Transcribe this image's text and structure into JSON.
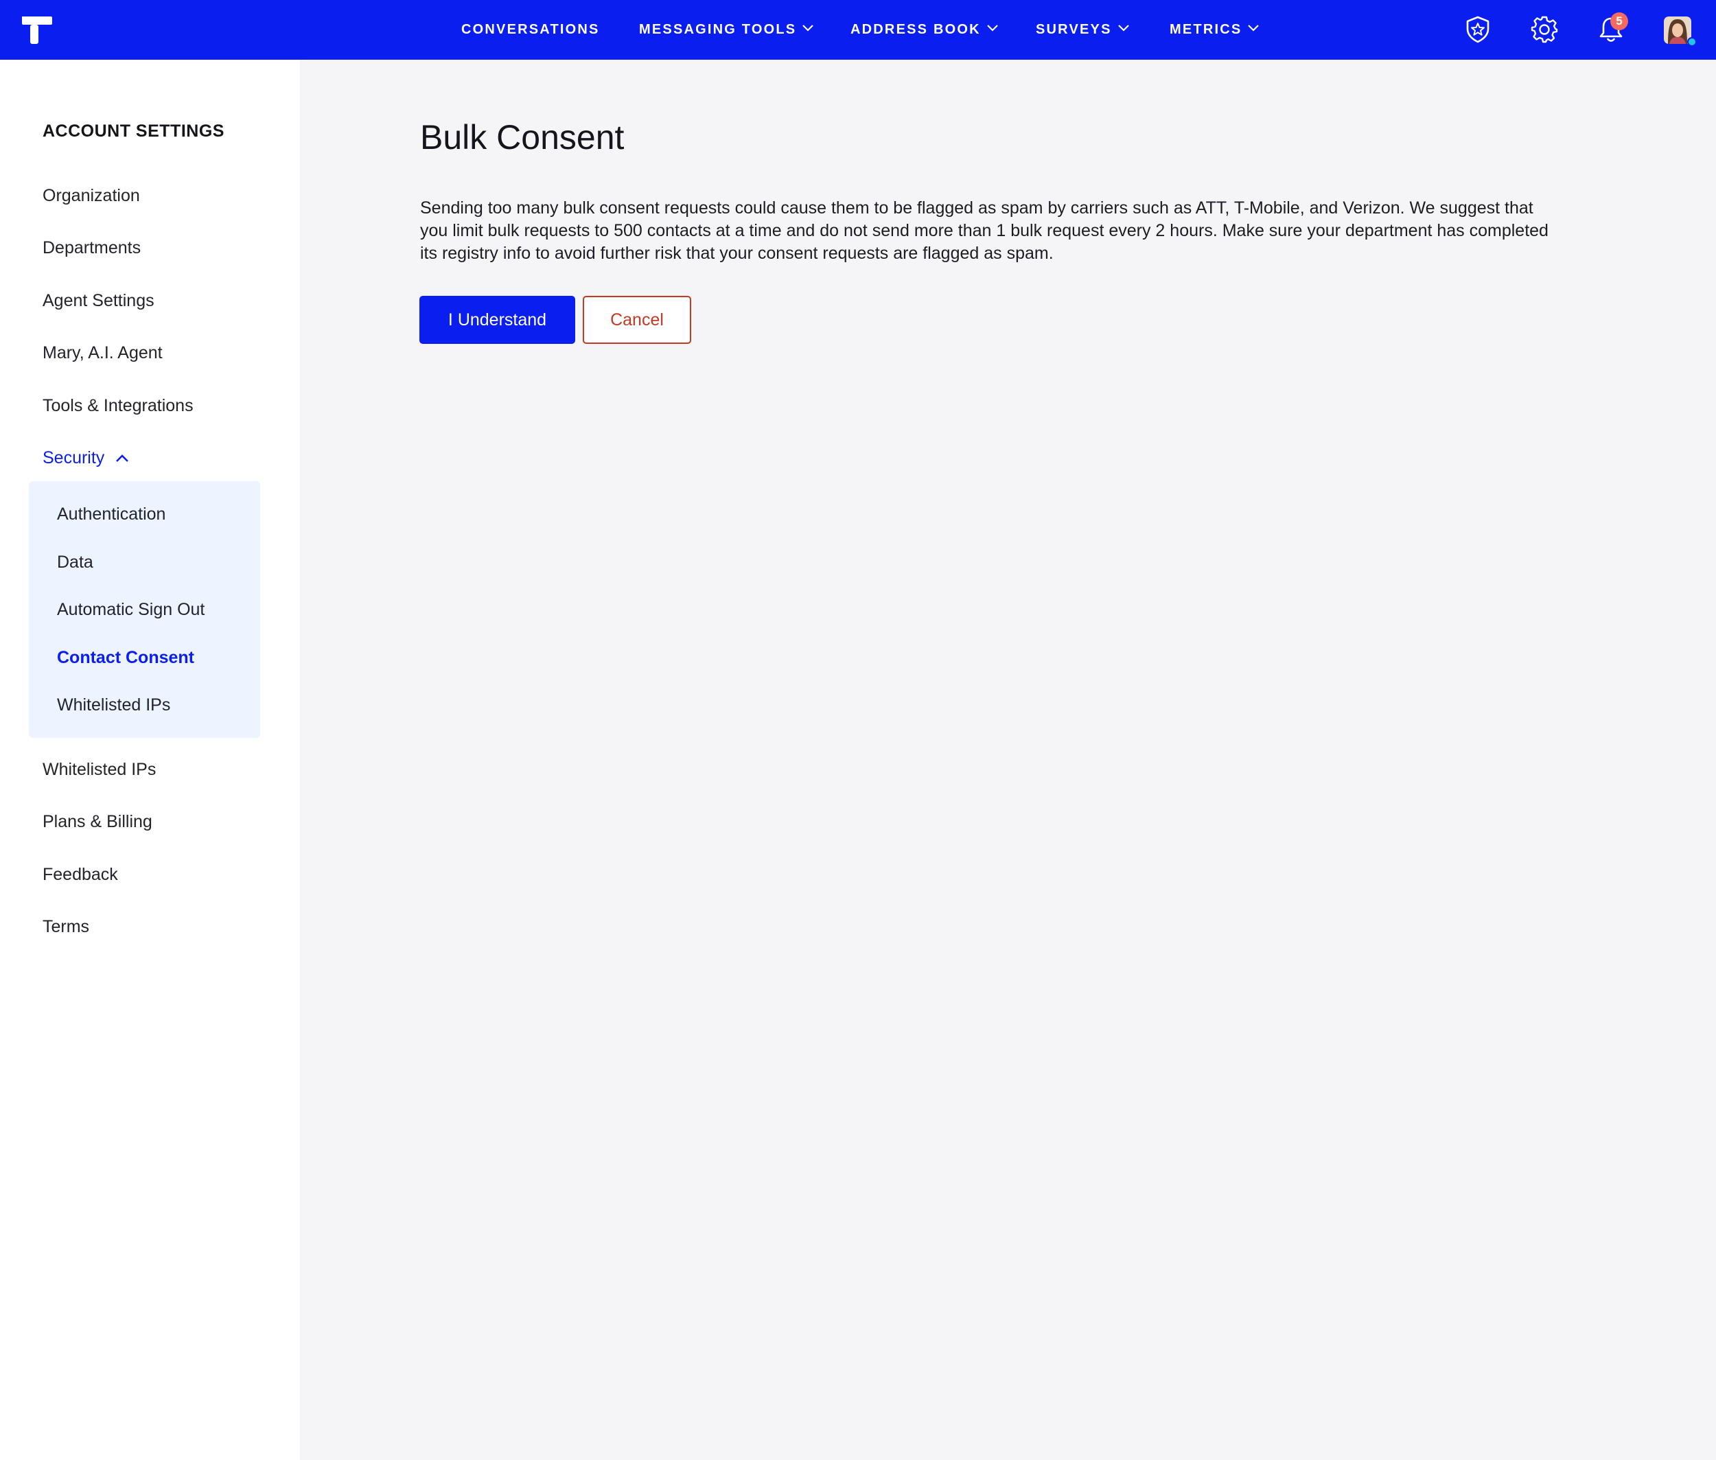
{
  "colors": {
    "brand": "#0a1ef0",
    "danger": "#c43a23",
    "badge": "#f36b5e",
    "presence": "#22c3e6",
    "submenu_bg": "#edf3ff"
  },
  "topnav": {
    "items": [
      {
        "label": "CONVERSATIONS",
        "has_dropdown": false
      },
      {
        "label": "MESSAGING TOOLS",
        "has_dropdown": true
      },
      {
        "label": "ADDRESS BOOK",
        "has_dropdown": true
      },
      {
        "label": "SURVEYS",
        "has_dropdown": true
      },
      {
        "label": "METRICS",
        "has_dropdown": true
      }
    ],
    "icons": [
      "shield-star-icon",
      "gear-icon",
      "bell-icon"
    ],
    "notification_count": "5"
  },
  "sidebar": {
    "title": "ACCOUNT SETTINGS",
    "items": [
      {
        "label": "Organization"
      },
      {
        "label": "Departments"
      },
      {
        "label": "Agent Settings"
      },
      {
        "label": "Mary, A.I. Agent"
      },
      {
        "label": "Tools & Integrations"
      },
      {
        "label": "Security",
        "expanded": true
      }
    ],
    "security_subitems": [
      {
        "label": "Authentication"
      },
      {
        "label": "Data"
      },
      {
        "label": "Automatic Sign Out"
      },
      {
        "label": "Contact Consent",
        "current": true
      },
      {
        "label": "Whitelisted IPs"
      }
    ],
    "items_after": [
      {
        "label": "Whitelisted IPs"
      },
      {
        "label": "Plans & Billing"
      },
      {
        "label": "Feedback"
      },
      {
        "label": "Terms"
      }
    ]
  },
  "main": {
    "title": "Bulk Consent",
    "description": "Sending too many bulk consent requests could cause them to be flagged as spam by carriers such as ATT, T-Mobile, and Verizon. We suggest that you limit bulk requests to 500 contacts at a time and do not send more than 1 bulk request every 2 hours. Make sure your department has completed its registry info to avoid further risk that your consent requests are flagged as spam.",
    "primary_button": "I Understand",
    "cancel_button": "Cancel"
  }
}
